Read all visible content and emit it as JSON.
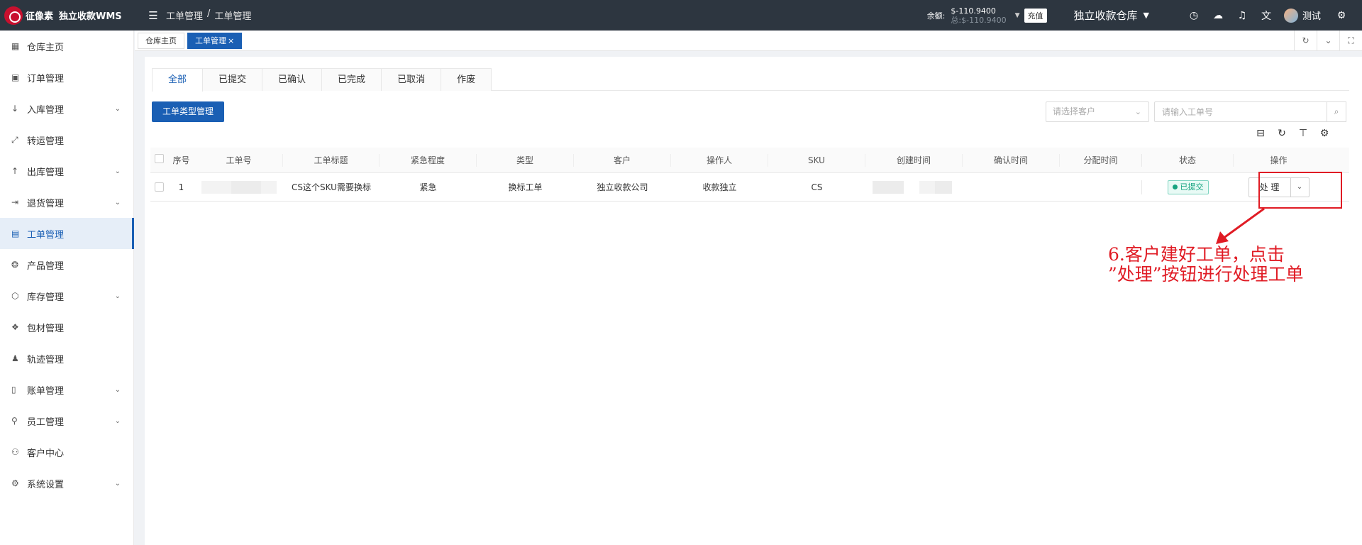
{
  "header": {
    "logo_text": "征像素",
    "app_name": "独立收款WMS",
    "breadcrumb": [
      "工单管理",
      "/",
      "工单管理"
    ],
    "balance_label": "余额:",
    "balance_main": "$-110.9400",
    "balance_total": "总:$-110.9400",
    "recharge_label": "充值",
    "warehouse": "独立收款仓库",
    "user_name": "测试"
  },
  "sidebar": {
    "items": [
      {
        "label": "仓库主页"
      },
      {
        "label": "订单管理"
      },
      {
        "label": "入库管理"
      },
      {
        "label": "转运管理"
      },
      {
        "label": "出库管理"
      },
      {
        "label": "退货管理"
      },
      {
        "label": "工单管理"
      },
      {
        "label": "产品管理"
      },
      {
        "label": "库存管理"
      },
      {
        "label": "包材管理"
      },
      {
        "label": "轨迹管理"
      },
      {
        "label": "账单管理"
      },
      {
        "label": "员工管理"
      },
      {
        "label": "客户中心"
      },
      {
        "label": "系统设置"
      }
    ],
    "active": "工单管理"
  },
  "tags": {
    "home": "仓库主页",
    "current": "工单管理",
    "close_glyph": "×"
  },
  "tabs": [
    "全部",
    "已提交",
    "已确认",
    "已完成",
    "已取消",
    "作废"
  ],
  "toolbar": {
    "type_manage_label": "工单类型管理",
    "customer_placeholder": "请选择客户",
    "ticket_no_placeholder": "请输入工单号"
  },
  "table": {
    "headers": {
      "seq": "序号",
      "ticket_no": "工单号",
      "title": "工单标题",
      "urgency": "紧急程度",
      "type": "类型",
      "customer": "客户",
      "operator": "操作人",
      "sku": "SKU",
      "created": "创建时间",
      "confirmed": "确认时间",
      "assigned": "分配时间",
      "status": "状态",
      "action": "操作"
    },
    "rows": [
      {
        "seq": "1",
        "title": "CS这个SKU需要换标",
        "urgency": "紧急",
        "type": "换标工单",
        "customer": "独立收款公司",
        "operator": "收款独立",
        "sku": "CS",
        "status": "已提交",
        "action": "处 理"
      }
    ]
  },
  "annotation": {
    "line1": "6.客户建好工单，点击",
    "line2": "”处理”按钮进行处理工单"
  },
  "colors": {
    "primary": "#1a5fb4",
    "topbar": "#2d3640",
    "status_green": "#14a37f",
    "annotation_red": "#e01b24"
  }
}
